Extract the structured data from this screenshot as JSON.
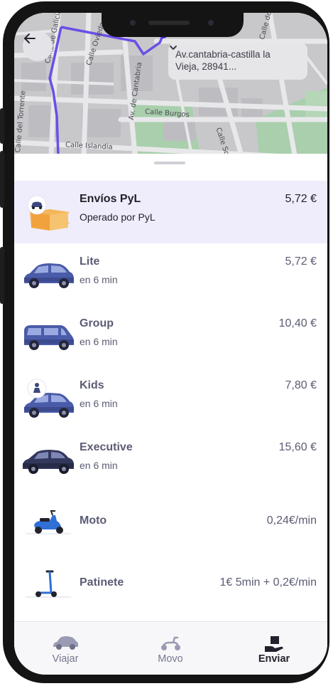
{
  "map": {
    "streets": [
      "Calle de Galicia",
      "Calle Oviedo",
      "Av. de Cantabria",
      "Calle Burgos",
      "Calle Islandia",
      "Calle Soria",
      "Calle de Zamora",
      "Calle del Torrente"
    ],
    "address": "Av.cantabria-castilla la Vieja, 28941...",
    "back_icon": "arrow-left-icon",
    "address_icon": "chevron-down-icon",
    "route_color": "#6b4ee6"
  },
  "options": [
    {
      "title": "Envíos PyL",
      "subtitle": "Operado por PyL",
      "price": "5,72 €",
      "icon": "package-car-icon",
      "selected": true
    },
    {
      "title": "Lite",
      "subtitle": "en 6 min",
      "price": "5,72 €",
      "icon": "car-lite-icon"
    },
    {
      "title": "Group",
      "subtitle": "en 6 min",
      "price": "10,40 €",
      "icon": "van-icon"
    },
    {
      "title": "Kids",
      "subtitle": "en 6 min",
      "price": "7,80 €",
      "icon": "child-seat-car-icon"
    },
    {
      "title": "Executive",
      "subtitle": "en 6 min",
      "price": "15,60 €",
      "icon": "executive-car-icon"
    },
    {
      "title": "Moto",
      "subtitle": "",
      "price": "0,24€/min",
      "icon": "scooter-moto-icon"
    },
    {
      "title": "Patinete",
      "subtitle": "",
      "price": "1€ 5min + 0,2€/min",
      "icon": "kick-scooter-icon"
    }
  ],
  "nav": [
    {
      "label": "Viajar",
      "icon": "car-icon",
      "active": false
    },
    {
      "label": "Movo",
      "icon": "scooter-icon",
      "active": false
    },
    {
      "label": "Enviar",
      "icon": "package-hand-icon",
      "active": true
    }
  ],
  "colors": {
    "accent": "#6b4ee6",
    "selected_bg": "#efedfb",
    "car_body": "#4a5ba8"
  }
}
